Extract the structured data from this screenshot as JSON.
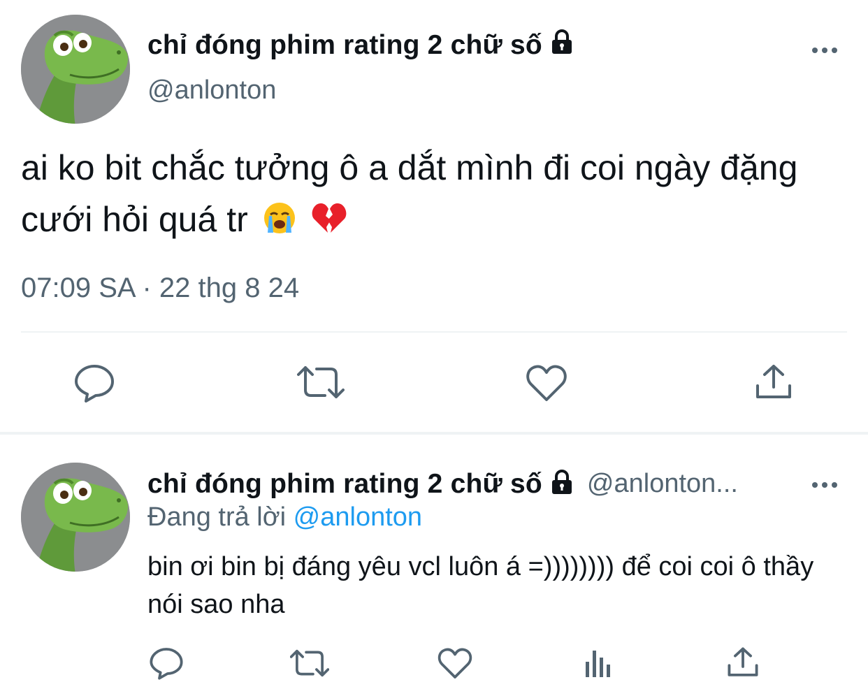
{
  "main_tweet": {
    "display_name": "chỉ đóng phim rating 2 chữ số",
    "handle": "@anlonton",
    "text": "ai ko bit chắc tưởng ô a dắt mình đi coi ngày đặng cưới hỏi quá tr",
    "emojis": [
      "loudly-crying-face-emoji",
      "broken-heart-emoji"
    ],
    "timestamp": "07:09 SA · 22 thg 8 24",
    "actions": [
      "reply-icon",
      "retweet-icon",
      "like-icon",
      "share-icon"
    ]
  },
  "reply_tweet": {
    "display_name": "chỉ đóng phim rating 2 chữ số",
    "handle": "@anlonton...",
    "replying_prefix": "Đang trả lời",
    "replying_to": "@anlonton",
    "text": "bin ơi bin bị đáng yêu vcl luôn á =)))))))) để coi coi ô thầy nói sao nha",
    "actions": [
      "reply-icon",
      "retweet-icon",
      "like-icon",
      "views-icon",
      "share-icon"
    ]
  },
  "colors": {
    "text_primary": "#0f1419",
    "text_secondary": "#536471",
    "link": "#1d9bf0",
    "divider": "#eff3f4",
    "icon": "#536471"
  }
}
